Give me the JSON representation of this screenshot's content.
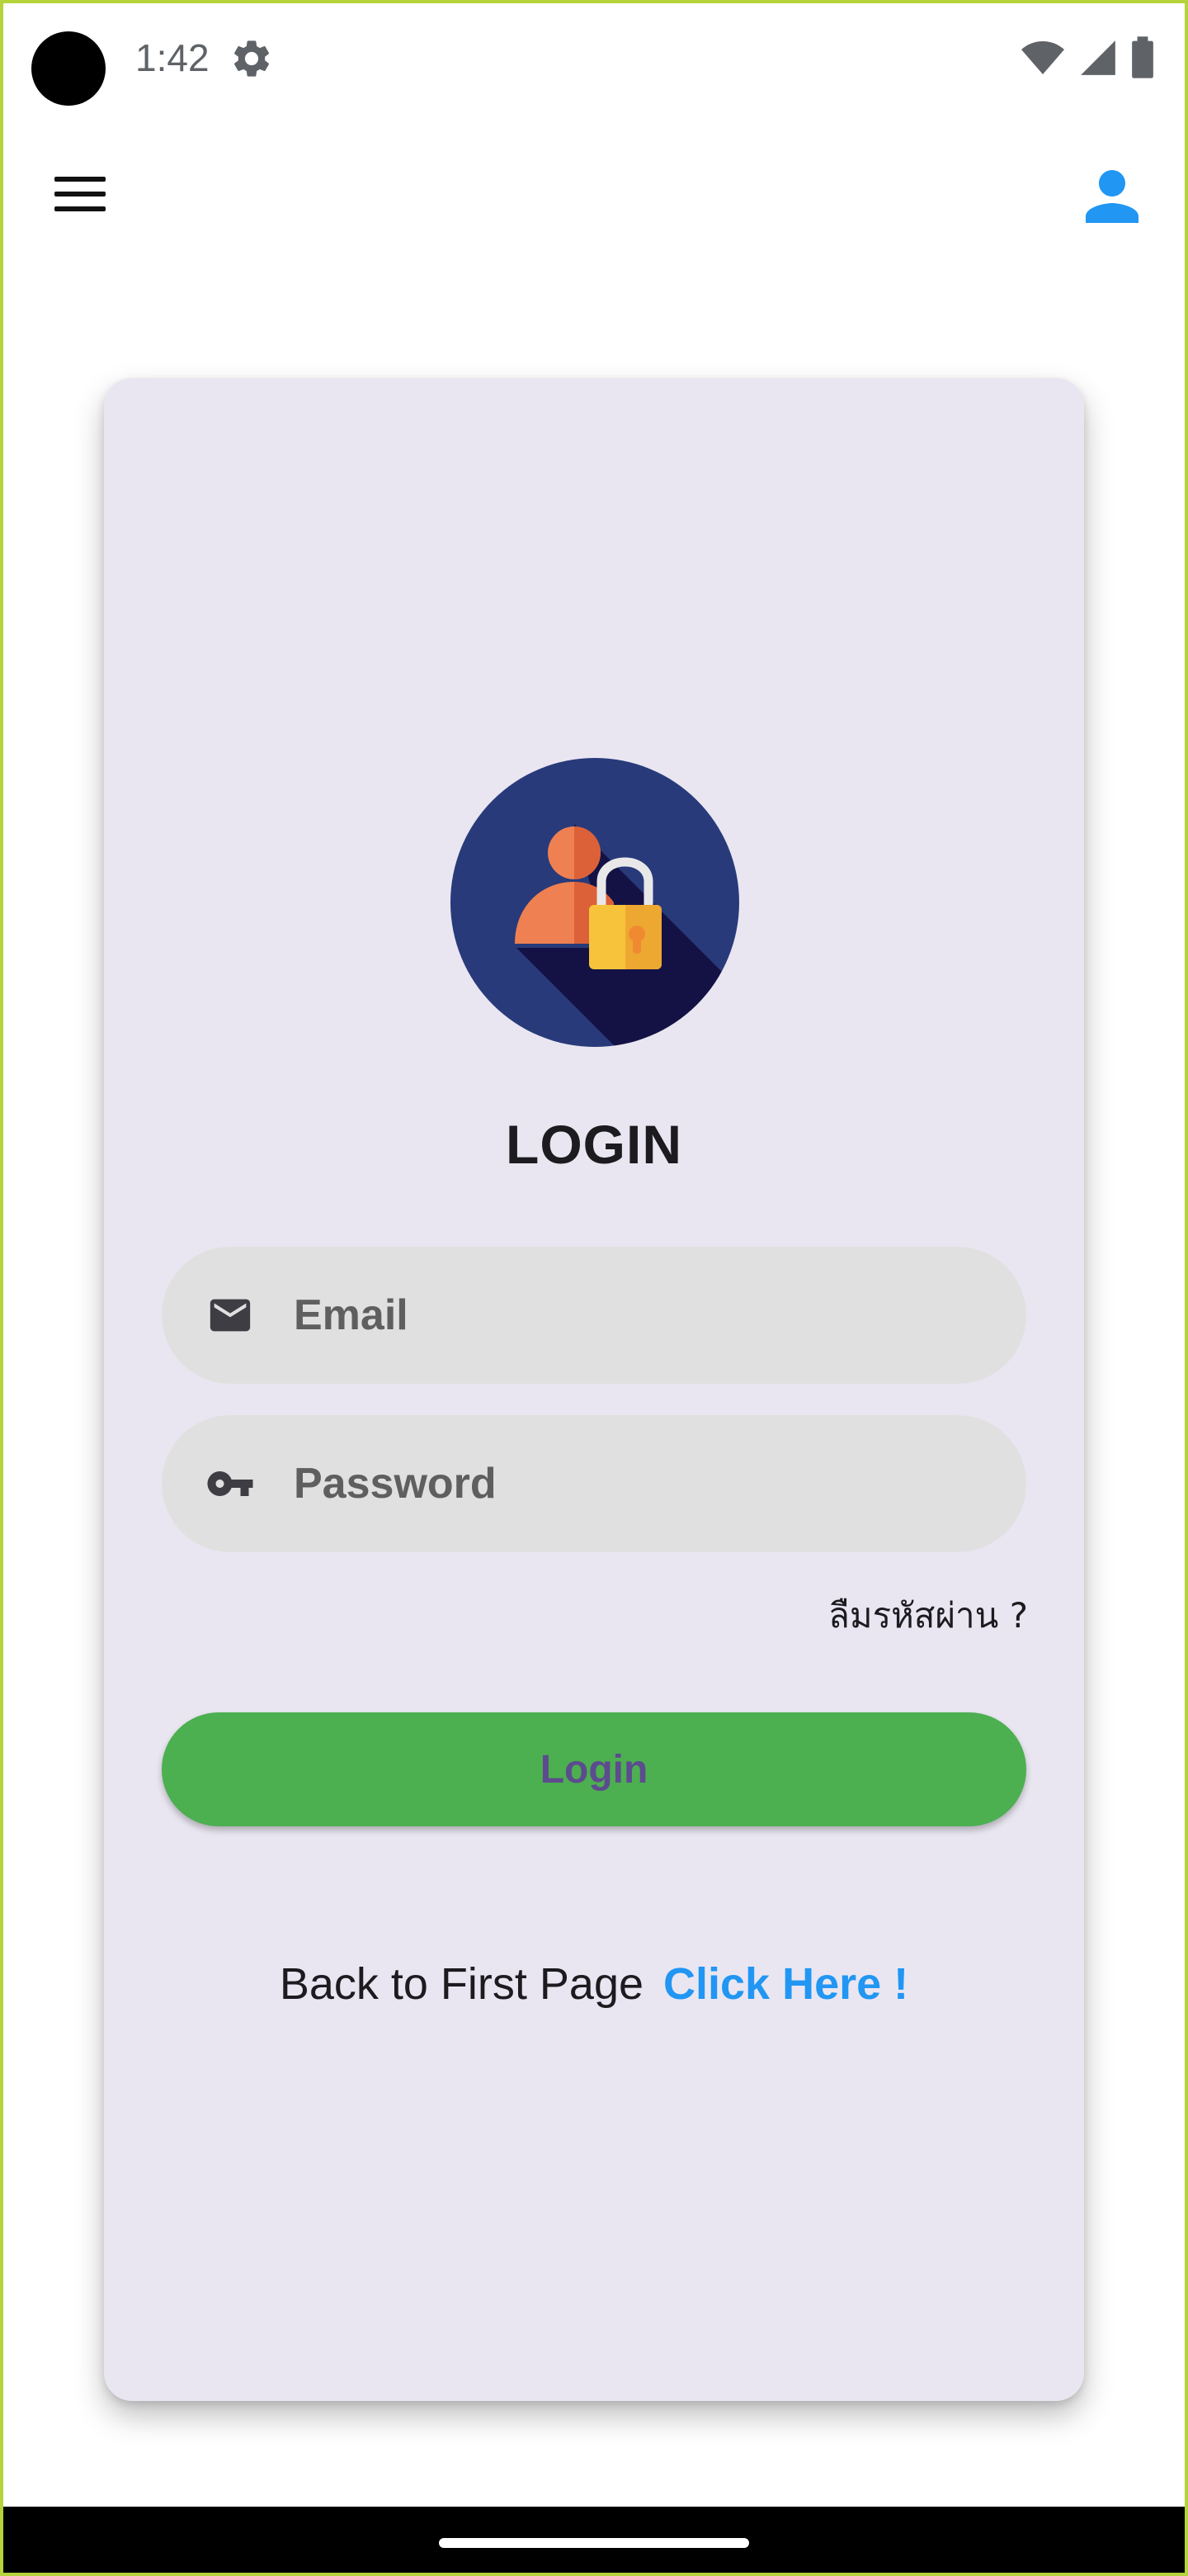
{
  "status_bar": {
    "time": "1:42",
    "icons": [
      "settings-gear-icon",
      "wifi-icon",
      "cellular-signal-icon",
      "battery-icon"
    ]
  },
  "app_bar": {
    "menu_icon": "hamburger-menu-icon",
    "profile_icon": "person-icon"
  },
  "login": {
    "logo_icon": "user-lock-icon",
    "title": "LOGIN",
    "email": {
      "icon": "mail-icon",
      "placeholder": "Email",
      "value": ""
    },
    "password": {
      "icon": "key-icon",
      "placeholder": "Password",
      "value": ""
    },
    "forgot_password": "ลืมรหัสผ่าน ?",
    "login_button": "Login",
    "back_text": "Back to First Page",
    "back_link": "Click Here !"
  },
  "colors": {
    "card_background": "#e9e6f1",
    "field_background": "#e0e0e0",
    "button_green": "#4caf50",
    "button_text": "#5d4b8f",
    "link_blue": "#2196f3",
    "profile_icon_blue": "#2196f3",
    "frame_border": "#b5d33a"
  }
}
